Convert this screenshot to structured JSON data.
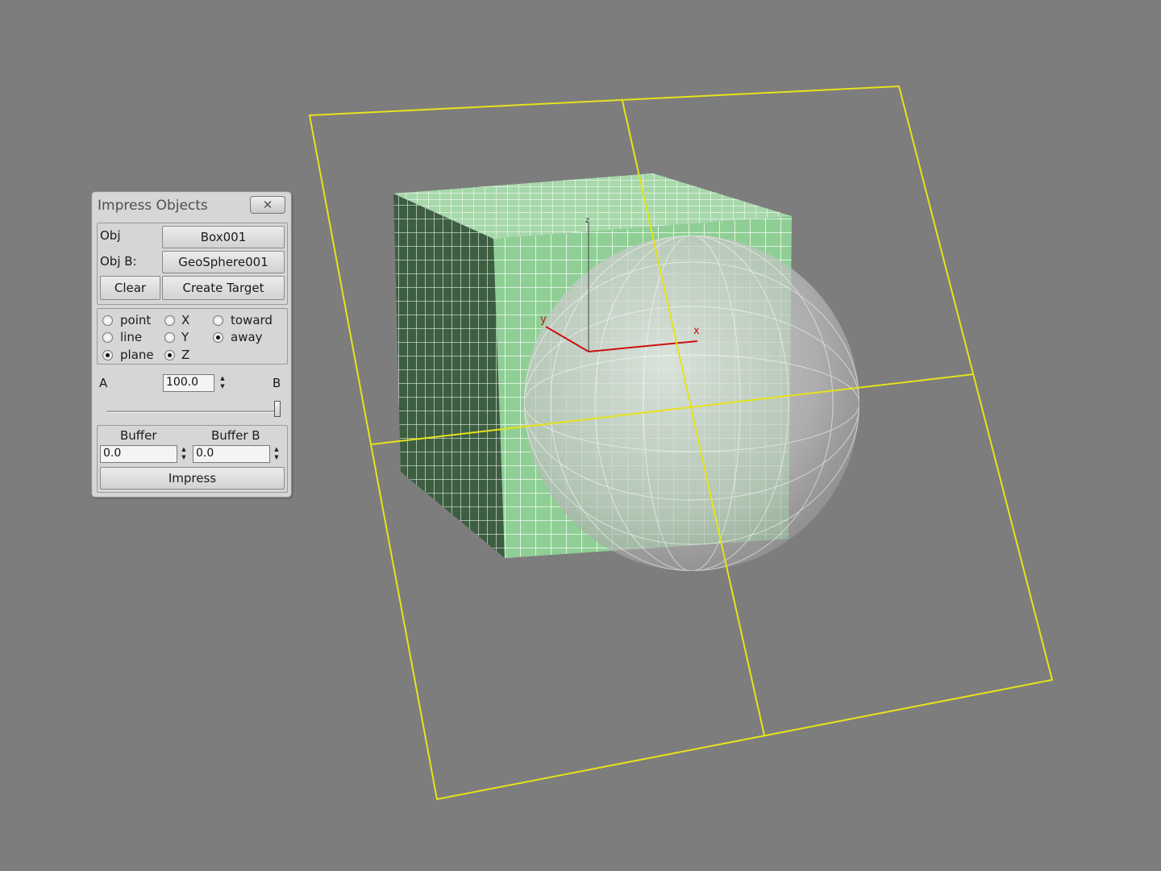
{
  "viewport": {
    "background": "#7d7d7d",
    "gizmo_color": "#e6e21c",
    "box_color": "#8fcf95",
    "sphere_color": "#d2d2d2",
    "axis_color": "#cc1111",
    "axis_labels": {
      "x": "x",
      "y": "y",
      "z": "z"
    }
  },
  "dialog": {
    "title": "Impress Objects",
    "close_icon": "✕",
    "obj_label": "Obj",
    "obj_value": "Box001",
    "objb_label": "Obj B:",
    "objb_value": "GeoSphere001",
    "clear_label": "Clear",
    "create_target_label": "Create Target",
    "mode_options": [
      {
        "label": "point",
        "checked": false
      },
      {
        "label": "line",
        "checked": false
      },
      {
        "label": "plane",
        "checked": true
      }
    ],
    "axis_options": [
      {
        "label": "X",
        "checked": false
      },
      {
        "label": "Y",
        "checked": false
      },
      {
        "label": "Z",
        "checked": true
      }
    ],
    "direction_options": [
      {
        "label": "toward",
        "checked": false
      },
      {
        "label": "away",
        "checked": true
      }
    ],
    "a_label": "A",
    "b_label": "B",
    "ab_value": "100.0",
    "slider_level": 1.0,
    "buffer_label": "Buffer",
    "bufferb_label": "Buffer B",
    "buffer_value": "0.0",
    "bufferb_value": "0.0",
    "impress_label": "Impress",
    "spinner_up_icon": "▲",
    "spinner_down_icon": "▼"
  }
}
